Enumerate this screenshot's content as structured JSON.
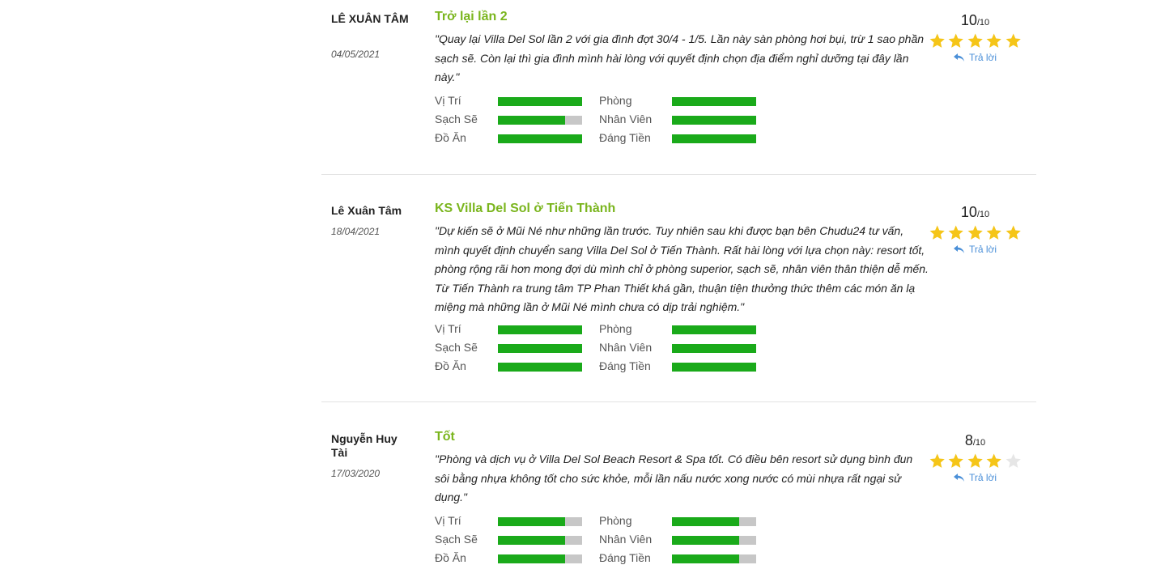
{
  "reviews": [
    {
      "author": "LÊ XUÂN TÂM",
      "date": "04/05/2021",
      "title": "Trở lại lần 2",
      "comment": "\"Quay lại Villa Del Sol lần 2 với gia đình đợt 30/4 - 1/5. Lần này sàn phòng hơi bụi, trừ 1 sao phần sạch sẽ. Còn lại thì gia đình mình hài lòng với quyết định chọn địa điểm nghỉ dưỡng tại đây lần này.\"",
      "score": "10",
      "score_max": "/10",
      "stars": 5,
      "reply_label": "Trả lời",
      "ratings": [
        {
          "label": "Vị Trí",
          "fraction": 1.0
        },
        {
          "label": "Phòng",
          "fraction": 1.0
        },
        {
          "label": "Sạch Sẽ",
          "fraction": 0.8
        },
        {
          "label": "Nhân Viên",
          "fraction": 1.0
        },
        {
          "label": "Đồ Ăn",
          "fraction": 1.0
        },
        {
          "label": "Đáng Tiền",
          "fraction": 1.0
        }
      ]
    },
    {
      "author": "Lê Xuân Tâm",
      "date": "18/04/2021",
      "title": "KS Villa Del Sol ở Tiến Thành",
      "comment": "\"Dự kiến sẽ ở Mũi Né như những lần trước. Tuy nhiên sau khi được bạn bên Chudu24 tư vấn, mình quyết định chuyển sang Villa Del Sol ở Tiến Thành. Rất hài lòng với lựa chọn này: resort tốt, phòng rộng rãi hơn mong đợi dù mình chỉ ở phòng superior, sạch sẽ, nhân viên thân thiện dễ mến. Từ Tiến Thành ra trung tâm TP Phan Thiết khá gần, thuận tiện thưởng thức thêm các món ăn lạ miệng mà những lần ở Mũi Né mình chưa có dịp trải nghiệm.\"",
      "score": "10",
      "score_max": "/10",
      "stars": 5,
      "reply_label": "Trả lời",
      "ratings": [
        {
          "label": "Vị Trí",
          "fraction": 1.0
        },
        {
          "label": "Phòng",
          "fraction": 1.0
        },
        {
          "label": "Sạch Sẽ",
          "fraction": 1.0
        },
        {
          "label": "Nhân Viên",
          "fraction": 1.0
        },
        {
          "label": "Đồ Ăn",
          "fraction": 1.0
        },
        {
          "label": "Đáng Tiền",
          "fraction": 1.0
        }
      ]
    },
    {
      "author": "Nguyễn Huy Tài",
      "date": "17/03/2020",
      "title": "Tốt",
      "comment": "\"Phòng và dịch vụ ở Villa Del Sol Beach Resort & Spa tốt. Có điều bên resort sử dụng bình đun sôi bằng nhựa không tốt cho sức khỏe, mỗi lần nấu nước xong nước có mùi nhựa rất ngại sử dụng.\"",
      "score": "8",
      "score_max": "/10",
      "stars": 4,
      "reply_label": "Trả lời",
      "ratings": [
        {
          "label": "Vị Trí",
          "fraction": 0.8
        },
        {
          "label": "Phòng",
          "fraction": 0.8
        },
        {
          "label": "Sạch Sẽ",
          "fraction": 0.8
        },
        {
          "label": "Nhân Viên",
          "fraction": 0.8
        },
        {
          "label": "Đồ Ăn",
          "fraction": 0.8
        },
        {
          "label": "Đáng Tiền",
          "fraction": 0.8
        }
      ]
    }
  ],
  "colors": {
    "title": "#7ab51d",
    "bar_fill": "#1aaa1a",
    "bar_track": "#c7c7c7",
    "star_on": "#f5c518",
    "star_off": "#e6e6e6",
    "reply": "#4a8fd8"
  }
}
